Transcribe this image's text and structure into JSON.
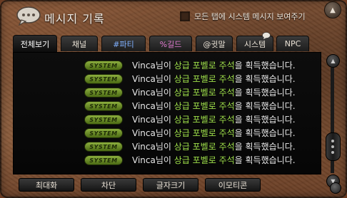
{
  "window": {
    "title": "메시지 기록",
    "show_all_checkbox_label": "모든 탭에 시스템 메시지 보여주기",
    "show_all_checked": false
  },
  "tabs": [
    {
      "label": "전체보기",
      "color": "#ffffff",
      "active": true
    },
    {
      "label": "채널",
      "color": "#e8e0d4",
      "active": false
    },
    {
      "label": "#파티",
      "color": "#7fb0ff",
      "active": false
    },
    {
      "label": "%길드",
      "color": "#e07ad0",
      "active": false
    },
    {
      "label": "@귓말",
      "color": "#e8e0d4",
      "active": false
    },
    {
      "label": "시스템",
      "color": "#e8e0d4",
      "active": false
    },
    {
      "label": "NPC",
      "color": "#e8e0d4",
      "active": false
    }
  ],
  "badge_label": "SYSTEM",
  "messages": [
    {
      "prefix": "Vinca님이 ",
      "highlight": "상급 포벨로 주석",
      "suffix": "을 획득했습니다."
    },
    {
      "prefix": "Vinca님이 ",
      "highlight": "상급 포벨로 주석",
      "suffix": "을 획득했습니다."
    },
    {
      "prefix": "Vinca님이 ",
      "highlight": "상급 포벨로 주석",
      "suffix": "을 획득했습니다."
    },
    {
      "prefix": "Vinca님이 ",
      "highlight": "상급 포벨로 주석",
      "suffix": "을 획득했습니다."
    },
    {
      "prefix": "Vinca님이 ",
      "highlight": "상급 포벨로 주석",
      "suffix": "을 획득했습니다."
    },
    {
      "prefix": "Vinca님이 ",
      "highlight": "상급 포벨로 주석",
      "suffix": "을 획득했습니다."
    },
    {
      "prefix": "Vinca님이 ",
      "highlight": "상급 포벨로 주석",
      "suffix": "을 획득했습니다."
    },
    {
      "prefix": "Vinca님이 ",
      "highlight": "상급 포벨로 주석",
      "suffix": "을 획득했습니다."
    }
  ],
  "bottom_buttons": {
    "maximize": "최대화",
    "block": "차단",
    "font_size": "글자크기",
    "emoticon": "이모티콘"
  },
  "icons": {
    "title": "speech-bubble-icon",
    "minimize": "chevron-up-icon",
    "scroll_up": "arrow-up-icon",
    "scroll_down": "arrow-down-icon",
    "resize": "resize-grip-icon"
  },
  "colors": {
    "highlight_text": "#9fe04a",
    "message_text": "#e8e8e8",
    "badge": "#8cae3e"
  },
  "scroll": {
    "position": 0.83
  }
}
